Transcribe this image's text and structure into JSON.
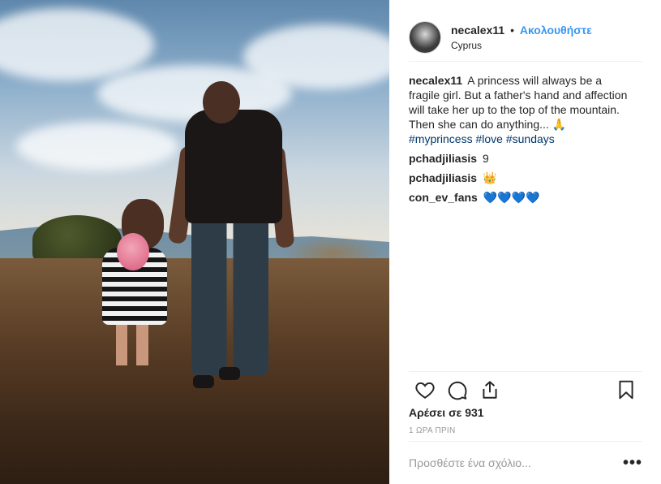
{
  "header": {
    "username": "necalex11",
    "separator": "•",
    "follow_label": "Ακολουθήστε",
    "location": "Cyprus"
  },
  "caption": {
    "username": "necalex11",
    "text": "A princess will always be a fragile girl. But a father's hand and affection will take her up to the top of the mountain. Then she can do anything... 🙏",
    "hashtags": [
      "#myprincess",
      "#love",
      "#sundays"
    ]
  },
  "comments": [
    {
      "username": "pchadjiliasis",
      "text": "9"
    },
    {
      "username": "pchadjiliasis",
      "text": "👑"
    },
    {
      "username": "con_ev_fans",
      "text": "💙💙💙💙"
    }
  ],
  "actions": {
    "like_icon": "heart-icon",
    "comment_icon": "comment-icon",
    "share_icon": "share-icon",
    "save_icon": "bookmark-icon"
  },
  "likes": "Αρέσει σε 931",
  "timestamp": "1 ΩΡΑ ΠΡΙΝ",
  "add_comment": {
    "placeholder": "Προσθέστε ένα σχόλιο...",
    "more_label": "•••"
  },
  "colors": {
    "link": "#3897f0",
    "hashtag": "#003569",
    "muted": "#999999"
  }
}
